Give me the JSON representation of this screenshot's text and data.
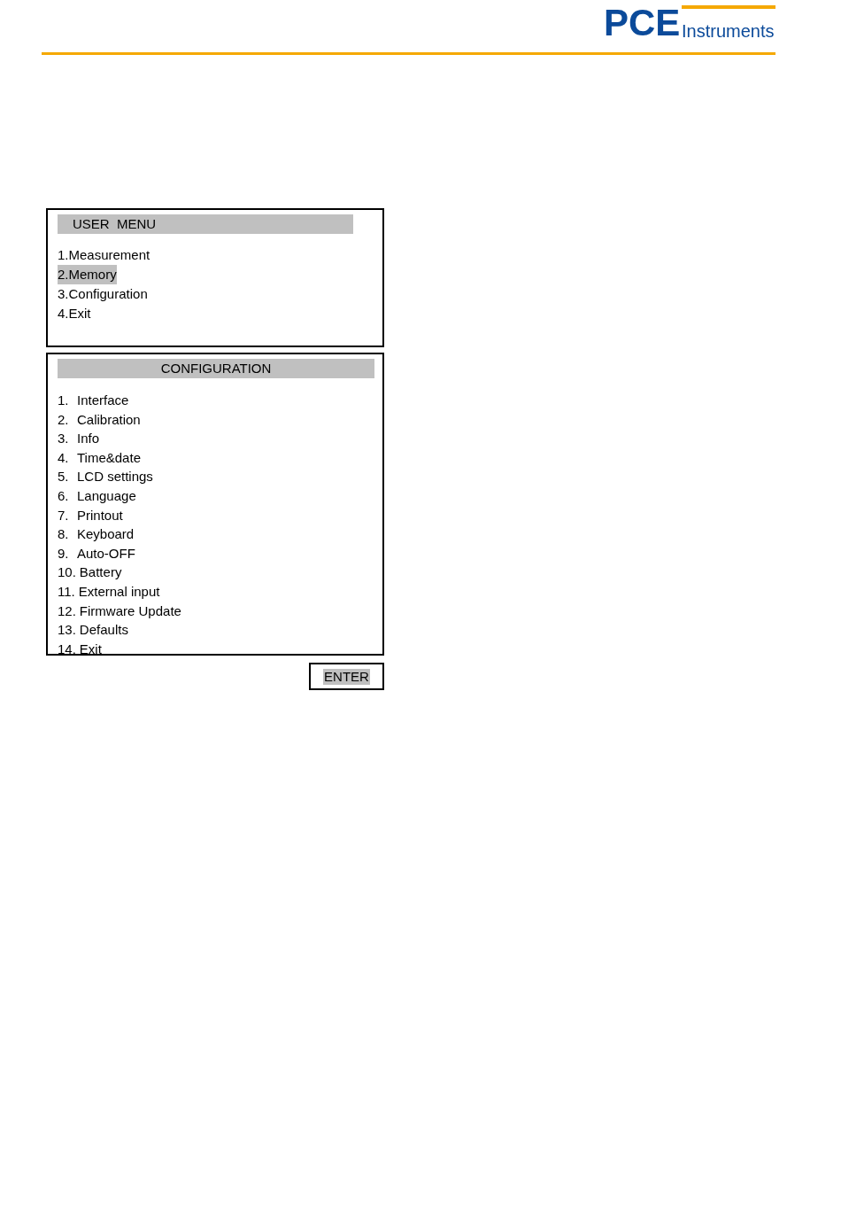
{
  "header": {
    "logo_mark": "PCE",
    "logo_text": "Instruments"
  },
  "user_menu": {
    "title": "USER  MENU",
    "items": [
      {
        "label": "1.Measurement",
        "selected": false
      },
      {
        "label": "2.Memory",
        "selected": true
      },
      {
        "label": "3.Configuration",
        "selected": false
      },
      {
        "label": "4.Exit",
        "selected": false
      }
    ]
  },
  "configuration": {
    "title": "CONFIGURATION",
    "items": [
      {
        "number": "1.",
        "label": "Interface"
      },
      {
        "number": "2.",
        "label": "Calibration"
      },
      {
        "number": "3.",
        "label": "Info"
      },
      {
        "number": "4.",
        "label": "Time&date"
      },
      {
        "number": "5.",
        "label": "LCD settings"
      },
      {
        "number": "6.",
        "label": "Language"
      },
      {
        "number": "7.",
        "label": "Printout"
      },
      {
        "number": "8.",
        "label": "Keyboard"
      },
      {
        "number": "9.",
        "label": "Auto-OFF"
      },
      {
        "number": "10.",
        "label": "Battery"
      },
      {
        "number": "11.",
        "label": "External input"
      },
      {
        "number": "12.",
        "label": "Firmware Update"
      },
      {
        "number": "13.",
        "label": "Defaults"
      },
      {
        "number": "14.",
        "label": "Exit"
      }
    ]
  },
  "enter_button": {
    "label": "ENTER",
    "highlighted": true
  }
}
